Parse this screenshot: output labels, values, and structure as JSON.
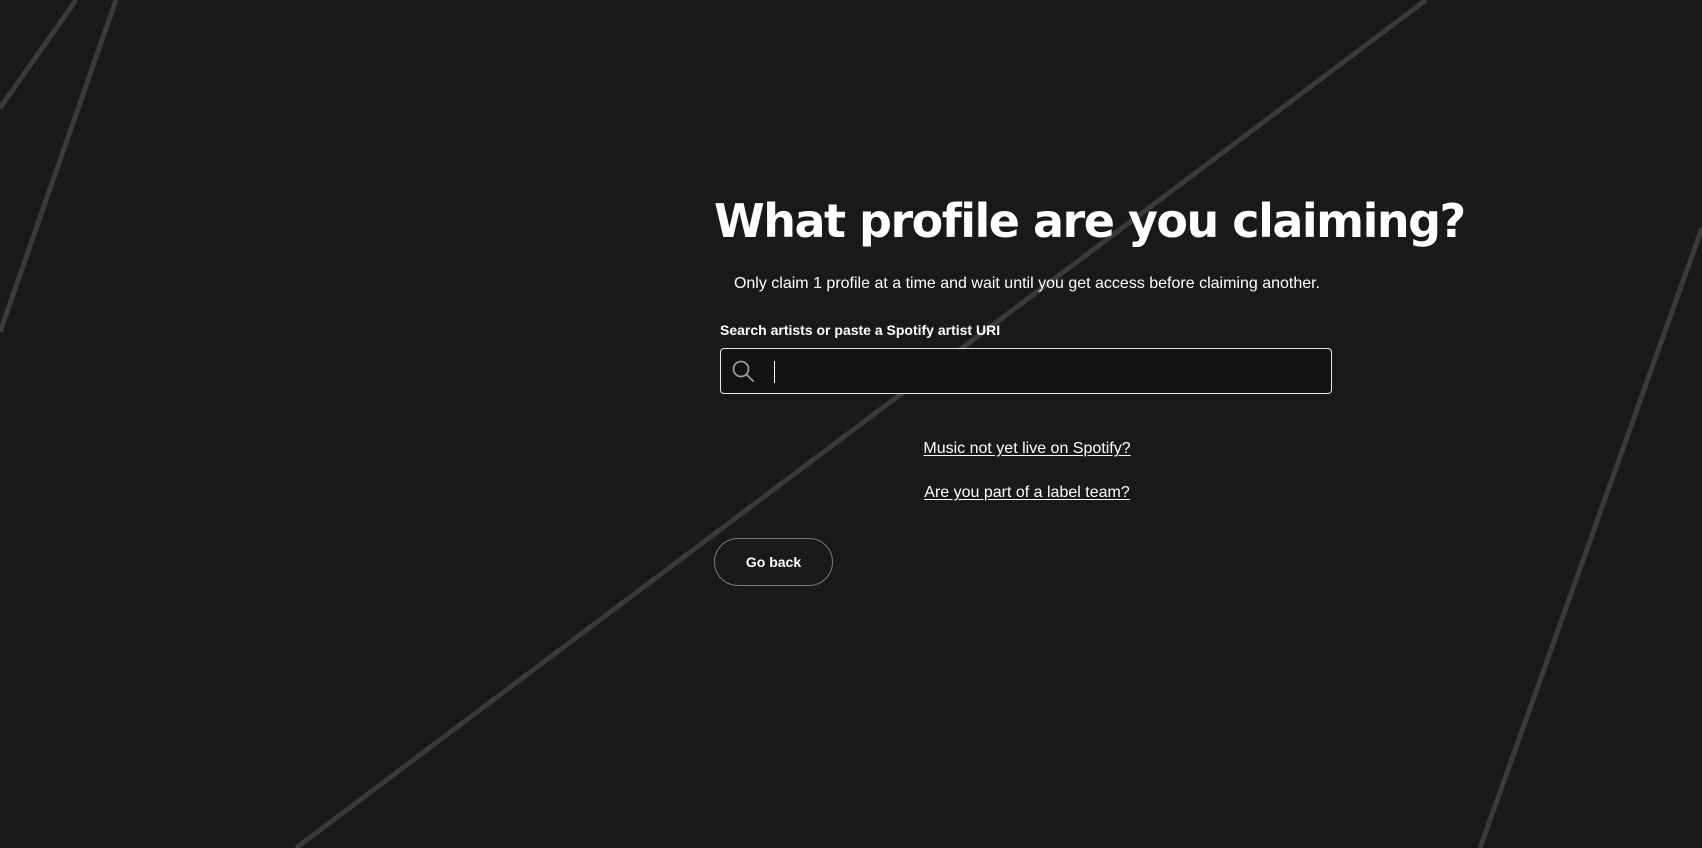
{
  "heading": {
    "title": "What profile are you claiming?",
    "subtitle": "Only claim 1 profile at a time and wait until you get access before claiming another."
  },
  "search": {
    "label": "Search artists or paste a Spotify artist URI",
    "value": "",
    "icon": "search-icon"
  },
  "links": {
    "not_live": "Music not yet live on Spotify?",
    "label_team": "Are you part of a label team?"
  },
  "actions": {
    "go_back": "Go back"
  },
  "colors": {
    "background": "#191919",
    "decor_lines": "#3a3a3a",
    "text": "#ffffff",
    "input_background": "#121212"
  }
}
